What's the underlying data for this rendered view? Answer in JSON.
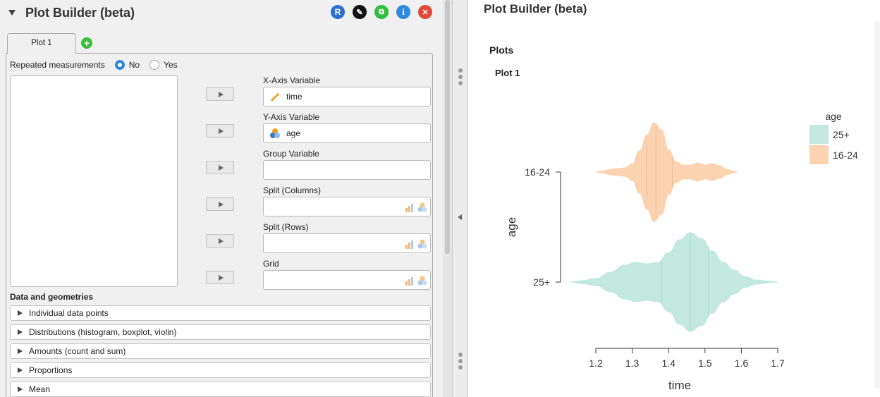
{
  "left_panel": {
    "title": "Plot Builder (beta)",
    "header_icons": [
      {
        "name": "r-icon",
        "label": "R",
        "color": "#2b6fd1"
      },
      {
        "name": "edit-icon",
        "label": "✎",
        "color": "#111111"
      },
      {
        "name": "copy-icon",
        "label": "⧉",
        "color": "#2fbf3a"
      },
      {
        "name": "info-icon",
        "label": "i",
        "color": "#2f8be0"
      },
      {
        "name": "close-icon",
        "label": "✕",
        "color": "#e04a3c"
      }
    ],
    "tab_label": "Plot 1",
    "add_tab": "+",
    "repeated_label": "Repeated measurements",
    "radio_no": "No",
    "radio_yes": "Yes",
    "fields": [
      {
        "label": "X-Axis Variable",
        "value": "time",
        "icon": "ruler-icon"
      },
      {
        "label": "Y-Axis Variable",
        "value": "age",
        "icon": "nominal-icon"
      },
      {
        "label": "Group Variable",
        "value": ""
      },
      {
        "label": "Split (Columns)",
        "value": ""
      },
      {
        "label": "Split (Rows)",
        "value": ""
      },
      {
        "label": "Grid",
        "value": ""
      }
    ],
    "section_label": "Data and geometries",
    "accordions": [
      "Individual data points",
      "Distributions (histogram, boxplot, violin)",
      "Amounts (count and sum)",
      "Proportions",
      "Mean"
    ]
  },
  "right_panel": {
    "title": "Plot Builder (beta)",
    "plots_heading": "Plots",
    "plot_heading": "Plot 1"
  },
  "chart_data": {
    "type": "violin",
    "xlabel": "time",
    "ylabel": "age",
    "x_ticks": [
      1.2,
      1.3,
      1.4,
      1.5,
      1.6,
      1.7
    ],
    "xlim": [
      1.2,
      1.7
    ],
    "categories": [
      "25+",
      "16-24"
    ],
    "legend_title": "age",
    "legend_position": "right",
    "grid": false,
    "series": [
      {
        "name": "16-24",
        "color": "#fcd3b0",
        "stroke": "#f7b98a",
        "quartiles": [
          1.34,
          1.365,
          1.41
        ],
        "density": [
          [
            1.2,
            0.0
          ],
          [
            1.22,
            0.015
          ],
          [
            1.24,
            0.04
          ],
          [
            1.26,
            0.05
          ],
          [
            1.28,
            0.06
          ],
          [
            1.3,
            0.12
          ],
          [
            1.32,
            0.3
          ],
          [
            1.34,
            0.52
          ],
          [
            1.36,
            0.7
          ],
          [
            1.38,
            0.6
          ],
          [
            1.4,
            0.32
          ],
          [
            1.42,
            0.15
          ],
          [
            1.44,
            0.1
          ],
          [
            1.46,
            0.1
          ],
          [
            1.48,
            0.13
          ],
          [
            1.5,
            0.1
          ],
          [
            1.52,
            0.12
          ],
          [
            1.54,
            0.09
          ],
          [
            1.56,
            0.04
          ],
          [
            1.58,
            0.01
          ],
          [
            1.59,
            0.0
          ]
        ]
      },
      {
        "name": "25+",
        "color": "#c3e8e0",
        "stroke": "#a6dacd",
        "quartiles": [
          1.38,
          1.46,
          1.51
        ],
        "density": [
          [
            1.13,
            0.0
          ],
          [
            1.16,
            0.02
          ],
          [
            1.2,
            0.05
          ],
          [
            1.24,
            0.14
          ],
          [
            1.28,
            0.24
          ],
          [
            1.31,
            0.28
          ],
          [
            1.34,
            0.26
          ],
          [
            1.37,
            0.28
          ],
          [
            1.4,
            0.42
          ],
          [
            1.43,
            0.6
          ],
          [
            1.46,
            0.7
          ],
          [
            1.49,
            0.62
          ],
          [
            1.52,
            0.44
          ],
          [
            1.55,
            0.28
          ],
          [
            1.58,
            0.17
          ],
          [
            1.61,
            0.08
          ],
          [
            1.64,
            0.03
          ],
          [
            1.68,
            0.01
          ],
          [
            1.7,
            0.0
          ]
        ]
      }
    ]
  }
}
